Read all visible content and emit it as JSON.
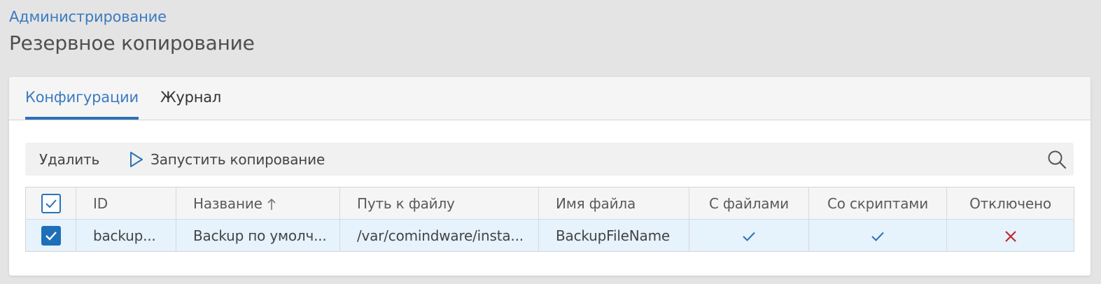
{
  "header": {
    "breadcrumb": "Администрирование",
    "title": "Резервное копирование"
  },
  "tabs": [
    {
      "label": "Конфигурации",
      "active": true
    },
    {
      "label": "Журнал",
      "active": false
    }
  ],
  "toolbar": {
    "delete_label": "Удалить",
    "run_label": "Запустить копирование",
    "icons": {
      "run": "play-outline-icon",
      "search": "search-icon"
    }
  },
  "table": {
    "columns": [
      "ID",
      "Название",
      "Путь к файлу",
      "Имя файла",
      "С файлами",
      "Со скриптами",
      "Отключено"
    ],
    "sort_column": "Название",
    "sort_direction": "asc",
    "rows": [
      {
        "selected": true,
        "id": "backup...",
        "name": "Backup по умолч...",
        "path": "/var/comindware/insta...",
        "file_name": "BackupFileName",
        "with_files": true,
        "with_scripts": true,
        "disabled": false
      }
    ]
  },
  "colors": {
    "accent": "#2b72b8",
    "link": "#3a7bc0",
    "row_selected": "#e6f2fc",
    "check_true": "#2b72b8",
    "check_false": "#c0282d"
  }
}
